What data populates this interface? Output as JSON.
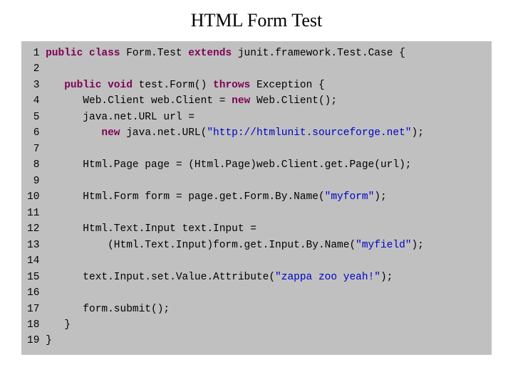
{
  "title": "HTML Form Test",
  "lines": [
    {
      "n": "1",
      "indent": "",
      "tokens": [
        {
          "t": "public",
          "c": "kw"
        },
        {
          "t": " "
        },
        {
          "t": "class",
          "c": "kw"
        },
        {
          "t": " Form.Test "
        },
        {
          "t": "extends",
          "c": "kw"
        },
        {
          "t": " junit.framework.Test.Case {"
        }
      ]
    },
    {
      "n": "2",
      "indent": "",
      "tokens": []
    },
    {
      "n": "3",
      "indent": "   ",
      "tokens": [
        {
          "t": "public",
          "c": "kw"
        },
        {
          "t": " "
        },
        {
          "t": "void",
          "c": "kw"
        },
        {
          "t": " test.Form() "
        },
        {
          "t": "throws",
          "c": "kw"
        },
        {
          "t": " Exception {"
        }
      ]
    },
    {
      "n": "4",
      "indent": "      ",
      "tokens": [
        {
          "t": "Web.Client web.Client = "
        },
        {
          "t": "new",
          "c": "kw"
        },
        {
          "t": " Web.Client();"
        }
      ]
    },
    {
      "n": "5",
      "indent": "      ",
      "tokens": [
        {
          "t": "java.net.URL url ="
        }
      ]
    },
    {
      "n": "6",
      "indent": "         ",
      "tokens": [
        {
          "t": "new",
          "c": "kw"
        },
        {
          "t": " java.net.URL("
        },
        {
          "t": "\"http://htmlunit.sourceforge.net\"",
          "c": "str"
        },
        {
          "t": ");"
        }
      ]
    },
    {
      "n": "7",
      "indent": "",
      "tokens": []
    },
    {
      "n": "8",
      "indent": "      ",
      "tokens": [
        {
          "t": "Html.Page page = (Html.Page)web.Client.get.Page(url);"
        }
      ]
    },
    {
      "n": "9",
      "indent": "",
      "tokens": []
    },
    {
      "n": "10",
      "indent": "      ",
      "tokens": [
        {
          "t": "Html.Form form = page.get.Form.By.Name("
        },
        {
          "t": "\"myform\"",
          "c": "str"
        },
        {
          "t": ");"
        }
      ]
    },
    {
      "n": "11",
      "indent": "",
      "tokens": []
    },
    {
      "n": "12",
      "indent": "      ",
      "tokens": [
        {
          "t": "Html.Text.Input text.Input ="
        }
      ]
    },
    {
      "n": "13",
      "indent": "          ",
      "tokens": [
        {
          "t": "(Html.Text.Input)form.get.Input.By.Name("
        },
        {
          "t": "\"myfield\"",
          "c": "str"
        },
        {
          "t": ");"
        }
      ]
    },
    {
      "n": "14",
      "indent": "",
      "tokens": []
    },
    {
      "n": "15",
      "indent": "      ",
      "tokens": [
        {
          "t": "text.Input.set.Value.Attribute("
        },
        {
          "t": "\"zappa zoo yeah!\"",
          "c": "str"
        },
        {
          "t": ");"
        }
      ]
    },
    {
      "n": "16",
      "indent": "",
      "tokens": []
    },
    {
      "n": "17",
      "indent": "      ",
      "tokens": [
        {
          "t": "form.submit();"
        }
      ]
    },
    {
      "n": "18",
      "indent": "   ",
      "tokens": [
        {
          "t": "}"
        }
      ]
    },
    {
      "n": "19",
      "indent": "",
      "tokens": [
        {
          "t": "}"
        }
      ]
    }
  ]
}
